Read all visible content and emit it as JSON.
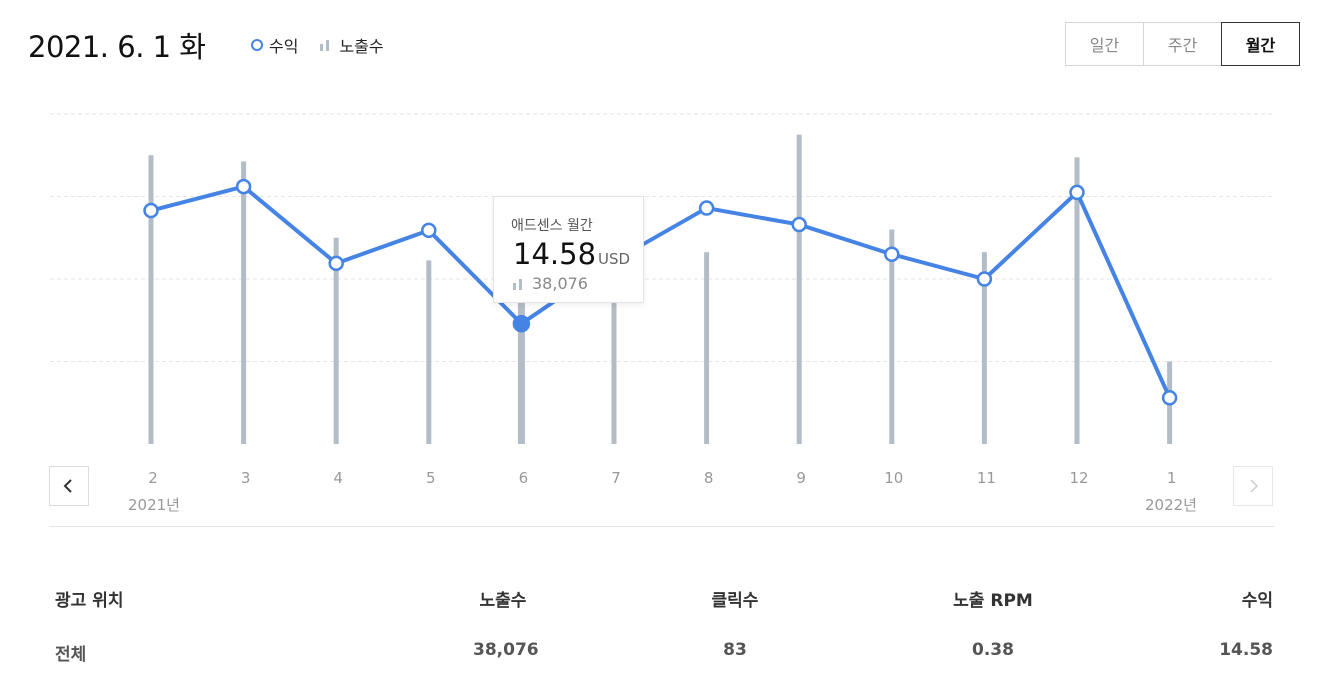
{
  "header": {
    "date_title": "2021. 6. 1 화",
    "legend": {
      "revenue_label": "수익",
      "impressions_label": "노출수"
    },
    "period_tabs": [
      {
        "label": "일간",
        "active": false
      },
      {
        "label": "주간",
        "active": false
      },
      {
        "label": "월간",
        "active": true
      }
    ]
  },
  "chart_data": {
    "type": "line",
    "categories": [
      "2",
      "3",
      "4",
      "5",
      "6",
      "7",
      "8",
      "9",
      "10",
      "11",
      "12",
      "1"
    ],
    "series": [
      {
        "name": "수익",
        "type": "line",
        "values": [
          28.3,
          31.2,
          21.9,
          25.9,
          14.58,
          22.2,
          28.6,
          26.6,
          23.0,
          20.0,
          30.5,
          5.6
        ]
      },
      {
        "name": "노출수",
        "type": "bar",
        "values": [
          70000,
          68500,
          50000,
          44500,
          38076,
          47000,
          46500,
          75000,
          52000,
          46500,
          69500,
          20000
        ]
      }
    ],
    "year_labels": {
      "start": "2021년",
      "end": "2022년"
    },
    "grid": true,
    "selected_index": 4,
    "colors": {
      "line": "#4583e4",
      "bar": "#b3bdc7",
      "grid": "#e6e6e6"
    }
  },
  "tooltip": {
    "title": "애드센스 월간",
    "value": "14.58",
    "unit": "USD",
    "impressions": "38,076"
  },
  "table": {
    "headers": [
      "광고 위치",
      "노출수",
      "클릭수",
      "노출 RPM",
      "수익"
    ],
    "rows": [
      [
        "전체",
        "38,076",
        "83",
        "0.38",
        "14.58"
      ]
    ]
  }
}
